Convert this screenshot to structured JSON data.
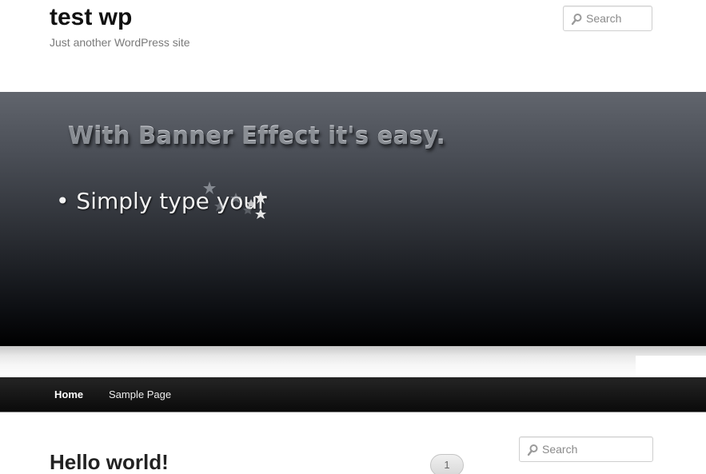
{
  "site": {
    "title": "test wp",
    "description": "Just another WordPress site"
  },
  "search_top": {
    "placeholder": "Search",
    "icon": "search-icon"
  },
  "banner": {
    "headline": "With Banner Effect it's easy.",
    "bullet": "• Simply type your"
  },
  "nav": {
    "items": [
      {
        "label": "Home"
      },
      {
        "label": "Sample Page"
      }
    ]
  },
  "post": {
    "title": "Hello world!",
    "comment_count": "1"
  },
  "search_sidebar": {
    "placeholder": "Search",
    "icon": "search-icon"
  },
  "colors": {
    "nav_bg": "#111111",
    "banner_top": "#61656d",
    "banner_bottom": "#000000",
    "title": "#111111"
  }
}
